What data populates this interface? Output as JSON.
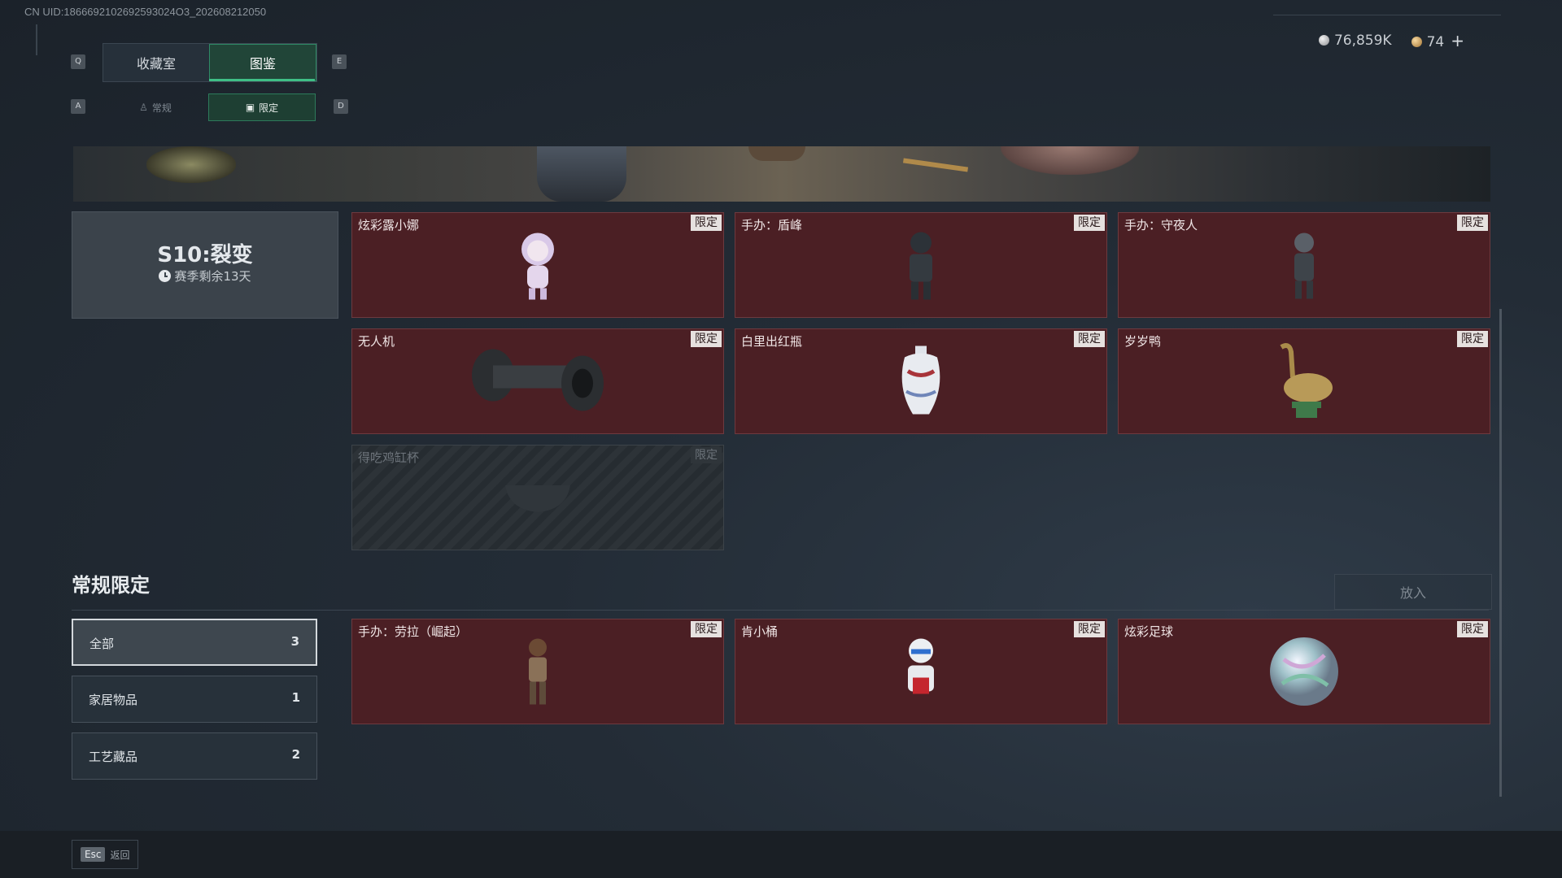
{
  "header": {
    "uid": "CN UID:1866692102692593024O3_202608212050",
    "key_left": "Q",
    "key_right": "E",
    "sub_key_left": "A",
    "sub_key_right": "D",
    "tabs": [
      {
        "label": "收藏室"
      },
      {
        "label": "图鉴"
      }
    ],
    "subtabs": [
      {
        "label": "常规"
      },
      {
        "label": "限定"
      }
    ]
  },
  "currency": {
    "silver": "76,859K",
    "gold": "74",
    "plus": "+"
  },
  "season": {
    "title": "S10:裂变",
    "remaining": "赛季剩余13天"
  },
  "limited_items": [
    {
      "name": "炫彩露小娜",
      "badge": "限定"
    },
    {
      "name": "手办：盾峰",
      "badge": "限定"
    },
    {
      "name": "手办：守夜人",
      "badge": "限定"
    },
    {
      "name": "无人机",
      "badge": "限定"
    },
    {
      "name": "白里出红瓶",
      "badge": "限定"
    },
    {
      "name": "岁岁鸭",
      "badge": "限定"
    },
    {
      "name": "得吃鸡缸杯",
      "badge": "限定"
    }
  ],
  "regular": {
    "title": "常规限定",
    "put_button": "放入",
    "categories": [
      {
        "label": "全部",
        "count": "3"
      },
      {
        "label": "家居物品",
        "count": "1"
      },
      {
        "label": "工艺藏品",
        "count": "2"
      }
    ],
    "items": [
      {
        "name": "手办：劳拉（崛起）",
        "badge": "限定"
      },
      {
        "name": "肯小桶",
        "badge": "限定"
      },
      {
        "name": "炫彩足球",
        "badge": "限定"
      }
    ]
  },
  "footer": {
    "esc_key": "Esc",
    "esc_label": "返回"
  }
}
